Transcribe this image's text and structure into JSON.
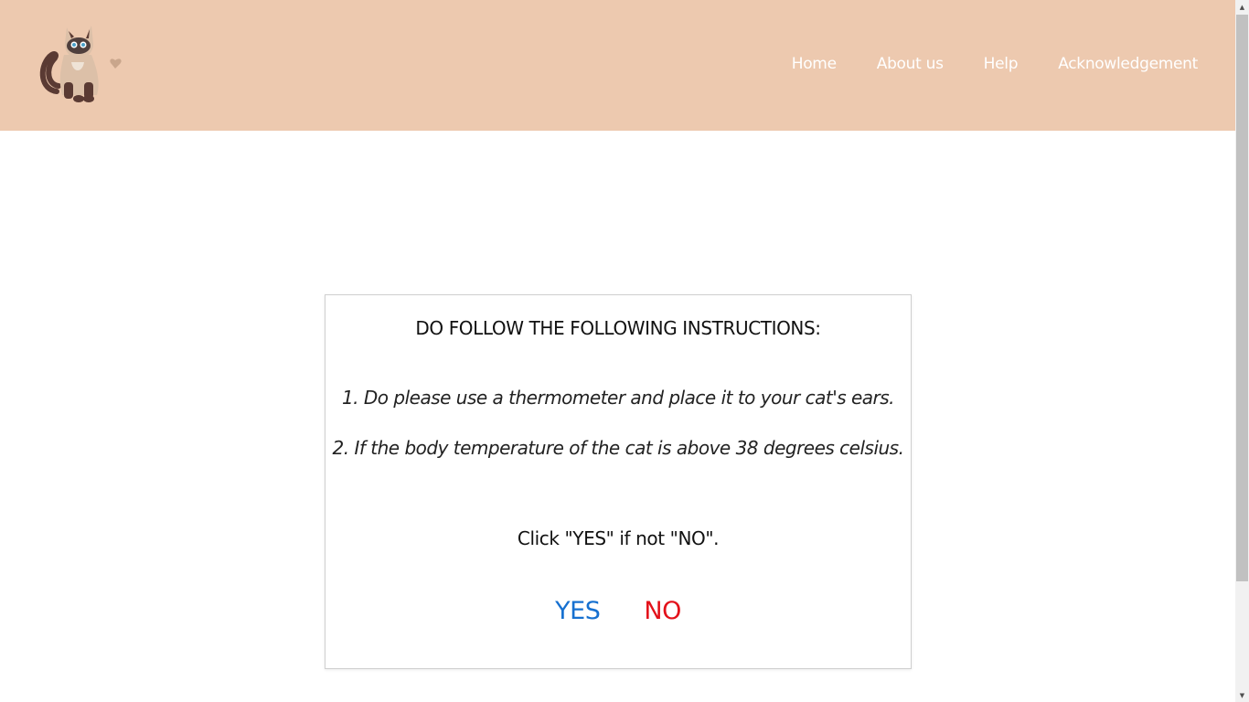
{
  "header": {
    "background_color": "#edc9af",
    "logo_icon": "cat-logo-icon",
    "nav": [
      {
        "label": "Home"
      },
      {
        "label": "About us"
      },
      {
        "label": "Help"
      },
      {
        "label": "Acknowledgement"
      }
    ]
  },
  "card": {
    "title": "DO FOLLOW THE FOLLOWING INSTRUCTIONS:",
    "steps": [
      "1. Do please use a thermometer and place it to your cat's ears.",
      "2. If the body temperature of the cat is above 38 degrees celsius."
    ],
    "prompt": "Click \"YES\" if not \"NO\".",
    "yes_label": "YES",
    "no_label": "NO",
    "yes_color": "#1670d0",
    "no_color": "#e3111a"
  },
  "scrollbar": {
    "up_icon": "scroll-up-arrow-icon",
    "down_icon": "scroll-down-arrow-icon"
  }
}
